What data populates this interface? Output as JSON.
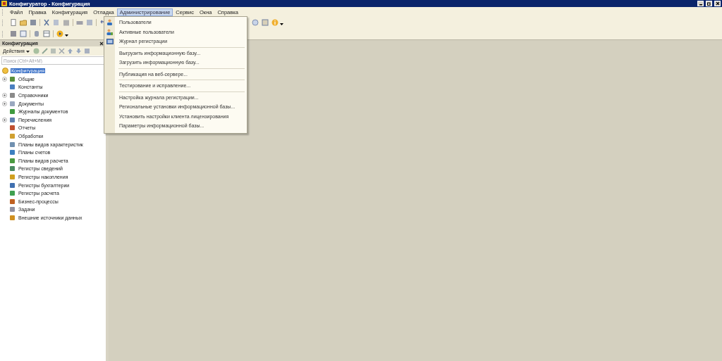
{
  "window": {
    "title": "Конфигуратор - Конфигурация"
  },
  "menu_bar": [
    {
      "label": "Файл",
      "selected": false
    },
    {
      "label": "Правка",
      "selected": false
    },
    {
      "label": "Конфигурация",
      "selected": false
    },
    {
      "label": "Отладка",
      "selected": false
    },
    {
      "label": "Администрирование",
      "selected": true
    },
    {
      "label": "Сервис",
      "selected": false
    },
    {
      "label": "Окна",
      "selected": false
    },
    {
      "label": "Справка",
      "selected": false
    }
  ],
  "dropdown": {
    "groups": [
      [
        {
          "label": "Пользователи",
          "kind": "user"
        },
        {
          "label": "Активные пользователи",
          "kind": "active"
        },
        {
          "label": "Журнал регистрации",
          "kind": "log"
        }
      ],
      [
        {
          "label": "Выгрузить информационную базу...",
          "kind": "plain"
        },
        {
          "label": "Загрузить информационную базу...",
          "kind": "plain"
        }
      ],
      [
        {
          "label": "Публикация на веб-сервере...",
          "kind": "plain"
        }
      ],
      [
        {
          "label": "Тестирование и исправление...",
          "kind": "plain"
        }
      ],
      [
        {
          "label": "Настройка журнала регистрации...",
          "kind": "plain"
        },
        {
          "label": "Региональные установки информационной базы...",
          "kind": "plain"
        },
        {
          "label": "Установить настройки клиента лицензирования",
          "kind": "plain"
        },
        {
          "label": "Параметры информационной базы...",
          "kind": "plain"
        }
      ]
    ]
  },
  "panel": {
    "title": "Конфигурация",
    "actions_label": "Действия",
    "search": {
      "placeholder": "Поиск (Ctrl+Alt+M)"
    },
    "tree": [
      {
        "label": "Конфигурация",
        "selected": true,
        "children": [
          {
            "label": "Общие",
            "expandable": true
          },
          {
            "label": "Константы",
            "expandable": false
          },
          {
            "label": "Справочники",
            "expandable": true
          },
          {
            "label": "Документы",
            "expandable": true
          },
          {
            "label": "Журналы документов",
            "expandable": false
          },
          {
            "label": "Перечисления",
            "expandable": true
          },
          {
            "label": "Отчеты",
            "expandable": false
          },
          {
            "label": "Обработки",
            "expandable": false
          },
          {
            "label": "Планы видов характеристик",
            "expandable": false
          },
          {
            "label": "Планы счетов",
            "expandable": false
          },
          {
            "label": "Планы видов расчета",
            "expandable": false
          },
          {
            "label": "Регистры сведений",
            "expandable": false
          },
          {
            "label": "Регистры накопления",
            "expandable": false
          },
          {
            "label": "Регистры бухгалтерии",
            "expandable": false
          },
          {
            "label": "Регистры расчета",
            "expandable": false
          },
          {
            "label": "Бизнес-процессы",
            "expandable": false
          },
          {
            "label": "Задачи",
            "expandable": false
          },
          {
            "label": "Внешние источники данных",
            "expandable": false
          }
        ]
      }
    ]
  }
}
